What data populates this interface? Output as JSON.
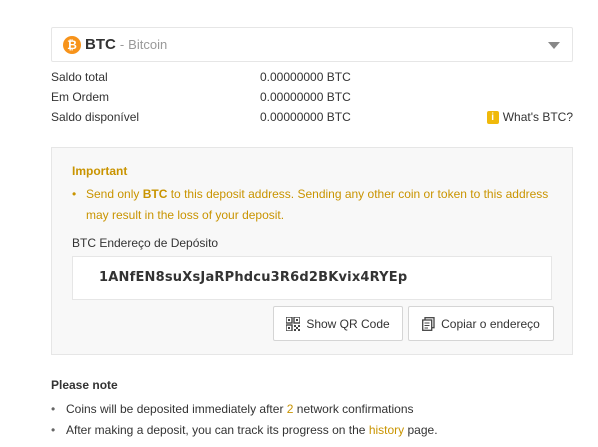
{
  "coin": {
    "logo_glyph": "₿",
    "symbol": "BTC",
    "separator": "-",
    "name": "Bitcoin",
    "logo_color": "#f7931a"
  },
  "balances": [
    {
      "label": "Saldo total",
      "value": "0.00000000 BTC"
    },
    {
      "label": "Em Ordem",
      "value": "0.00000000 BTC"
    },
    {
      "label": "Saldo disponível",
      "value": "0.00000000 BTC"
    }
  ],
  "whats_btc": {
    "icon_glyph": "i",
    "label": "What's BTC?"
  },
  "important": {
    "title": "Important",
    "bullet": "•",
    "text_before": "Send only ",
    "text_bold": "BTC",
    "text_after": " to this deposit address. Sending any other coin or token to this address may result in the loss of your deposit.",
    "accent_color": "#c99400"
  },
  "deposit": {
    "label": "BTC Endereço de Depósito",
    "address": "1ANfEN8suXsJaRPhdcu3R6d2BKvix4RYEp",
    "show_qr_label": "Show QR Code",
    "copy_label": "Copiar o endereço"
  },
  "notes": {
    "title": "Please note",
    "bullet": "•",
    "item1_before": "Coins will be deposited immediately after ",
    "item1_highlight": "2",
    "item1_after": " network confirmations",
    "item2_before": "After making a deposit, you can track its progress on the ",
    "item2_link": "history",
    "item2_after": " page."
  }
}
